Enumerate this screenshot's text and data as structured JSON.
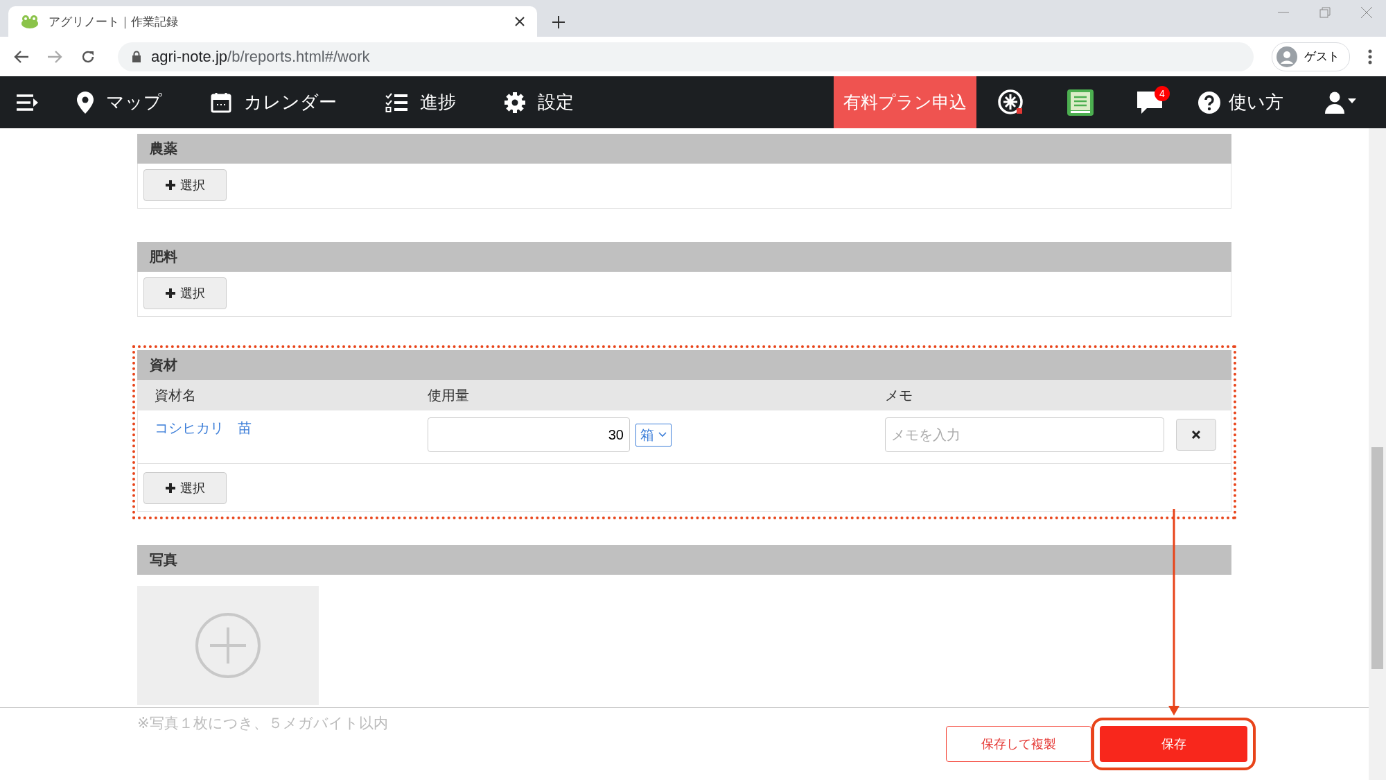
{
  "browser": {
    "tab_title": "アグリノート｜作業記録",
    "url_host": "agri-note.jp",
    "url_path": "/b/reports.html#/work",
    "profile": "ゲスト"
  },
  "nav": {
    "items": [
      {
        "kind": "map",
        "label": "マップ"
      },
      {
        "kind": "calendar",
        "label": "カレンダー"
      },
      {
        "kind": "progress",
        "label": "進捗"
      },
      {
        "kind": "settings",
        "label": "設定"
      }
    ],
    "plan_button": "有料プラン申込",
    "notification_count": "4",
    "help": "使い方"
  },
  "sections": [
    {
      "title": "農薬",
      "kind": "empty",
      "add_button": "選択"
    },
    {
      "title": "肥料",
      "kind": "empty",
      "add_button": "選択"
    },
    {
      "title": "資材",
      "kind": "table",
      "columns": [
        "資材名",
        "使用量",
        "メモ"
      ],
      "rows": [
        {
          "name": "コシヒカリ　苗",
          "quantity": "30",
          "unit": "箱",
          "memo_placeholder": "メモを入力"
        }
      ],
      "add_button": "選択",
      "highlighted": true
    },
    {
      "title": "写真",
      "kind": "photo"
    }
  ],
  "photo_note": "※写真１枚につき、５メガバイト以内",
  "footer": {
    "buttons": [
      {
        "label": "保存して複製",
        "kind": "secondary",
        "highlighted": false
      },
      {
        "label": "保存",
        "kind": "primary",
        "highlighted": true
      }
    ]
  }
}
